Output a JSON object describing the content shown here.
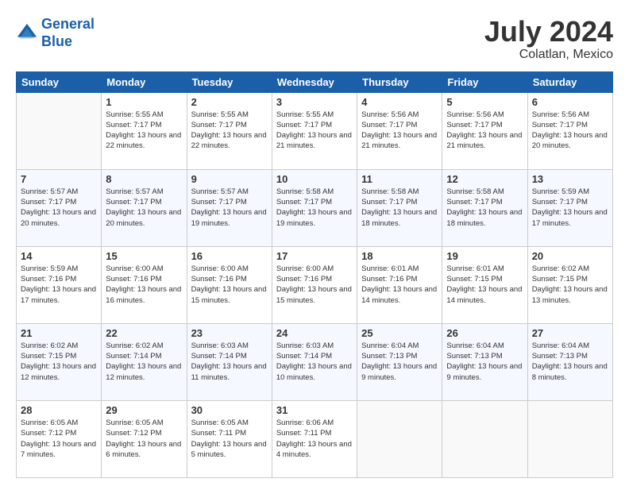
{
  "logo": {
    "line1": "General",
    "line2": "Blue"
  },
  "title": "July 2024",
  "location": "Colatlan, Mexico",
  "headers": [
    "Sunday",
    "Monday",
    "Tuesday",
    "Wednesday",
    "Thursday",
    "Friday",
    "Saturday"
  ],
  "weeks": [
    [
      {
        "day": "",
        "sunrise": "",
        "sunset": "",
        "daylight": ""
      },
      {
        "day": "1",
        "sunrise": "Sunrise: 5:55 AM",
        "sunset": "Sunset: 7:17 PM",
        "daylight": "Daylight: 13 hours and 22 minutes."
      },
      {
        "day": "2",
        "sunrise": "Sunrise: 5:55 AM",
        "sunset": "Sunset: 7:17 PM",
        "daylight": "Daylight: 13 hours and 22 minutes."
      },
      {
        "day": "3",
        "sunrise": "Sunrise: 5:55 AM",
        "sunset": "Sunset: 7:17 PM",
        "daylight": "Daylight: 13 hours and 21 minutes."
      },
      {
        "day": "4",
        "sunrise": "Sunrise: 5:56 AM",
        "sunset": "Sunset: 7:17 PM",
        "daylight": "Daylight: 13 hours and 21 minutes."
      },
      {
        "day": "5",
        "sunrise": "Sunrise: 5:56 AM",
        "sunset": "Sunset: 7:17 PM",
        "daylight": "Daylight: 13 hours and 21 minutes."
      },
      {
        "day": "6",
        "sunrise": "Sunrise: 5:56 AM",
        "sunset": "Sunset: 7:17 PM",
        "daylight": "Daylight: 13 hours and 20 minutes."
      }
    ],
    [
      {
        "day": "7",
        "sunrise": "Sunrise: 5:57 AM",
        "sunset": "Sunset: 7:17 PM",
        "daylight": "Daylight: 13 hours and 20 minutes."
      },
      {
        "day": "8",
        "sunrise": "Sunrise: 5:57 AM",
        "sunset": "Sunset: 7:17 PM",
        "daylight": "Daylight: 13 hours and 20 minutes."
      },
      {
        "day": "9",
        "sunrise": "Sunrise: 5:57 AM",
        "sunset": "Sunset: 7:17 PM",
        "daylight": "Daylight: 13 hours and 19 minutes."
      },
      {
        "day": "10",
        "sunrise": "Sunrise: 5:58 AM",
        "sunset": "Sunset: 7:17 PM",
        "daylight": "Daylight: 13 hours and 19 minutes."
      },
      {
        "day": "11",
        "sunrise": "Sunrise: 5:58 AM",
        "sunset": "Sunset: 7:17 PM",
        "daylight": "Daylight: 13 hours and 18 minutes."
      },
      {
        "day": "12",
        "sunrise": "Sunrise: 5:58 AM",
        "sunset": "Sunset: 7:17 PM",
        "daylight": "Daylight: 13 hours and 18 minutes."
      },
      {
        "day": "13",
        "sunrise": "Sunrise: 5:59 AM",
        "sunset": "Sunset: 7:17 PM",
        "daylight": "Daylight: 13 hours and 17 minutes."
      }
    ],
    [
      {
        "day": "14",
        "sunrise": "Sunrise: 5:59 AM",
        "sunset": "Sunset: 7:16 PM",
        "daylight": "Daylight: 13 hours and 17 minutes."
      },
      {
        "day": "15",
        "sunrise": "Sunrise: 6:00 AM",
        "sunset": "Sunset: 7:16 PM",
        "daylight": "Daylight: 13 hours and 16 minutes."
      },
      {
        "day": "16",
        "sunrise": "Sunrise: 6:00 AM",
        "sunset": "Sunset: 7:16 PM",
        "daylight": "Daylight: 13 hours and 15 minutes."
      },
      {
        "day": "17",
        "sunrise": "Sunrise: 6:00 AM",
        "sunset": "Sunset: 7:16 PM",
        "daylight": "Daylight: 13 hours and 15 minutes."
      },
      {
        "day": "18",
        "sunrise": "Sunrise: 6:01 AM",
        "sunset": "Sunset: 7:16 PM",
        "daylight": "Daylight: 13 hours and 14 minutes."
      },
      {
        "day": "19",
        "sunrise": "Sunrise: 6:01 AM",
        "sunset": "Sunset: 7:15 PM",
        "daylight": "Daylight: 13 hours and 14 minutes."
      },
      {
        "day": "20",
        "sunrise": "Sunrise: 6:02 AM",
        "sunset": "Sunset: 7:15 PM",
        "daylight": "Daylight: 13 hours and 13 minutes."
      }
    ],
    [
      {
        "day": "21",
        "sunrise": "Sunrise: 6:02 AM",
        "sunset": "Sunset: 7:15 PM",
        "daylight": "Daylight: 13 hours and 12 minutes."
      },
      {
        "day": "22",
        "sunrise": "Sunrise: 6:02 AM",
        "sunset": "Sunset: 7:14 PM",
        "daylight": "Daylight: 13 hours and 12 minutes."
      },
      {
        "day": "23",
        "sunrise": "Sunrise: 6:03 AM",
        "sunset": "Sunset: 7:14 PM",
        "daylight": "Daylight: 13 hours and 11 minutes."
      },
      {
        "day": "24",
        "sunrise": "Sunrise: 6:03 AM",
        "sunset": "Sunset: 7:14 PM",
        "daylight": "Daylight: 13 hours and 10 minutes."
      },
      {
        "day": "25",
        "sunrise": "Sunrise: 6:04 AM",
        "sunset": "Sunset: 7:13 PM",
        "daylight": "Daylight: 13 hours and 9 minutes."
      },
      {
        "day": "26",
        "sunrise": "Sunrise: 6:04 AM",
        "sunset": "Sunset: 7:13 PM",
        "daylight": "Daylight: 13 hours and 9 minutes."
      },
      {
        "day": "27",
        "sunrise": "Sunrise: 6:04 AM",
        "sunset": "Sunset: 7:13 PM",
        "daylight": "Daylight: 13 hours and 8 minutes."
      }
    ],
    [
      {
        "day": "28",
        "sunrise": "Sunrise: 6:05 AM",
        "sunset": "Sunset: 7:12 PM",
        "daylight": "Daylight: 13 hours and 7 minutes."
      },
      {
        "day": "29",
        "sunrise": "Sunrise: 6:05 AM",
        "sunset": "Sunset: 7:12 PM",
        "daylight": "Daylight: 13 hours and 6 minutes."
      },
      {
        "day": "30",
        "sunrise": "Sunrise: 6:05 AM",
        "sunset": "Sunset: 7:11 PM",
        "daylight": "Daylight: 13 hours and 5 minutes."
      },
      {
        "day": "31",
        "sunrise": "Sunrise: 6:06 AM",
        "sunset": "Sunset: 7:11 PM",
        "daylight": "Daylight: 13 hours and 4 minutes."
      },
      {
        "day": "",
        "sunrise": "",
        "sunset": "",
        "daylight": ""
      },
      {
        "day": "",
        "sunrise": "",
        "sunset": "",
        "daylight": ""
      },
      {
        "day": "",
        "sunrise": "",
        "sunset": "",
        "daylight": ""
      }
    ]
  ]
}
